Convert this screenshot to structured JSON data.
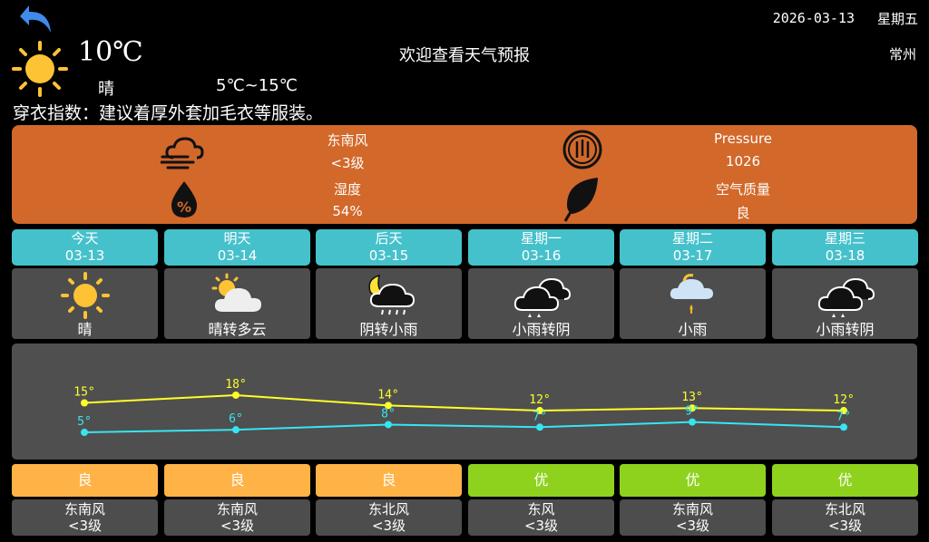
{
  "header": {
    "date": "2026-03-13",
    "weekday": "星期五",
    "city": "常州",
    "welcome": "欢迎查看天气预报"
  },
  "current": {
    "icon": "sun-icon",
    "temp": "10℃",
    "condition": "晴",
    "range": "5℃~15℃",
    "dress_index": "穿衣指数：建议着厚外套加毛衣等服装。"
  },
  "details": {
    "wind_dir": "东南风",
    "wind_level": "<3级",
    "humidity_label": "湿度",
    "humidity": "54%",
    "pressure_label": "Pressure",
    "pressure": "1026",
    "air_label": "空气质量",
    "air": "良"
  },
  "colors": {
    "panel": "#d2682a",
    "tab": "#45c1cb",
    "card": "#4d4d4d",
    "aq_good": "#ffb347",
    "aq_excellent": "#8fd21e",
    "high_line": "#ffff2a",
    "low_line": "#35e6f2"
  },
  "days": [
    {
      "name": "今天",
      "date": "03-13",
      "icon": "sun-icon",
      "cond": "晴",
      "high": "15°",
      "low": "5°",
      "aq": "良",
      "wind": "东南风",
      "level": "<3级"
    },
    {
      "name": "明天",
      "date": "03-14",
      "icon": "sun-cloud-icon",
      "cond": "晴转多云",
      "high": "18°",
      "low": "6°",
      "aq": "良",
      "wind": "东南风",
      "level": "<3级"
    },
    {
      "name": "后天",
      "date": "03-15",
      "icon": "moon-rain-cloud-icon",
      "cond": "阴转小雨",
      "high": "14°",
      "low": "8°",
      "aq": "良",
      "wind": "东北风",
      "level": "<3级"
    },
    {
      "name": "星期一",
      "date": "03-16",
      "icon": "rain-cloud-icon",
      "cond": "小雨转阴",
      "high": "12°",
      "low": "7°",
      "aq": "优",
      "wind": "东风",
      "level": "<3级"
    },
    {
      "name": "星期二",
      "date": "03-17",
      "icon": "light-rain-icon",
      "cond": "小雨",
      "high": "13°",
      "low": "9°",
      "aq": "优",
      "wind": "东南风",
      "level": "<3级"
    },
    {
      "name": "星期三",
      "date": "03-18",
      "icon": "rain-cloud-icon",
      "cond": "小雨转阴",
      "high": "12°",
      "low": "7°",
      "aq": "优",
      "wind": "东北风",
      "level": "<3级"
    }
  ],
  "chart_data": {
    "type": "line",
    "categories": [
      "03-13",
      "03-14",
      "03-15",
      "03-16",
      "03-17",
      "03-18"
    ],
    "series": [
      {
        "values": [
          15,
          18,
          14,
          12,
          13,
          12
        ]
      },
      {
        "values": [
          5,
          6,
          8,
          7,
          9,
          7
        ]
      }
    ]
  }
}
